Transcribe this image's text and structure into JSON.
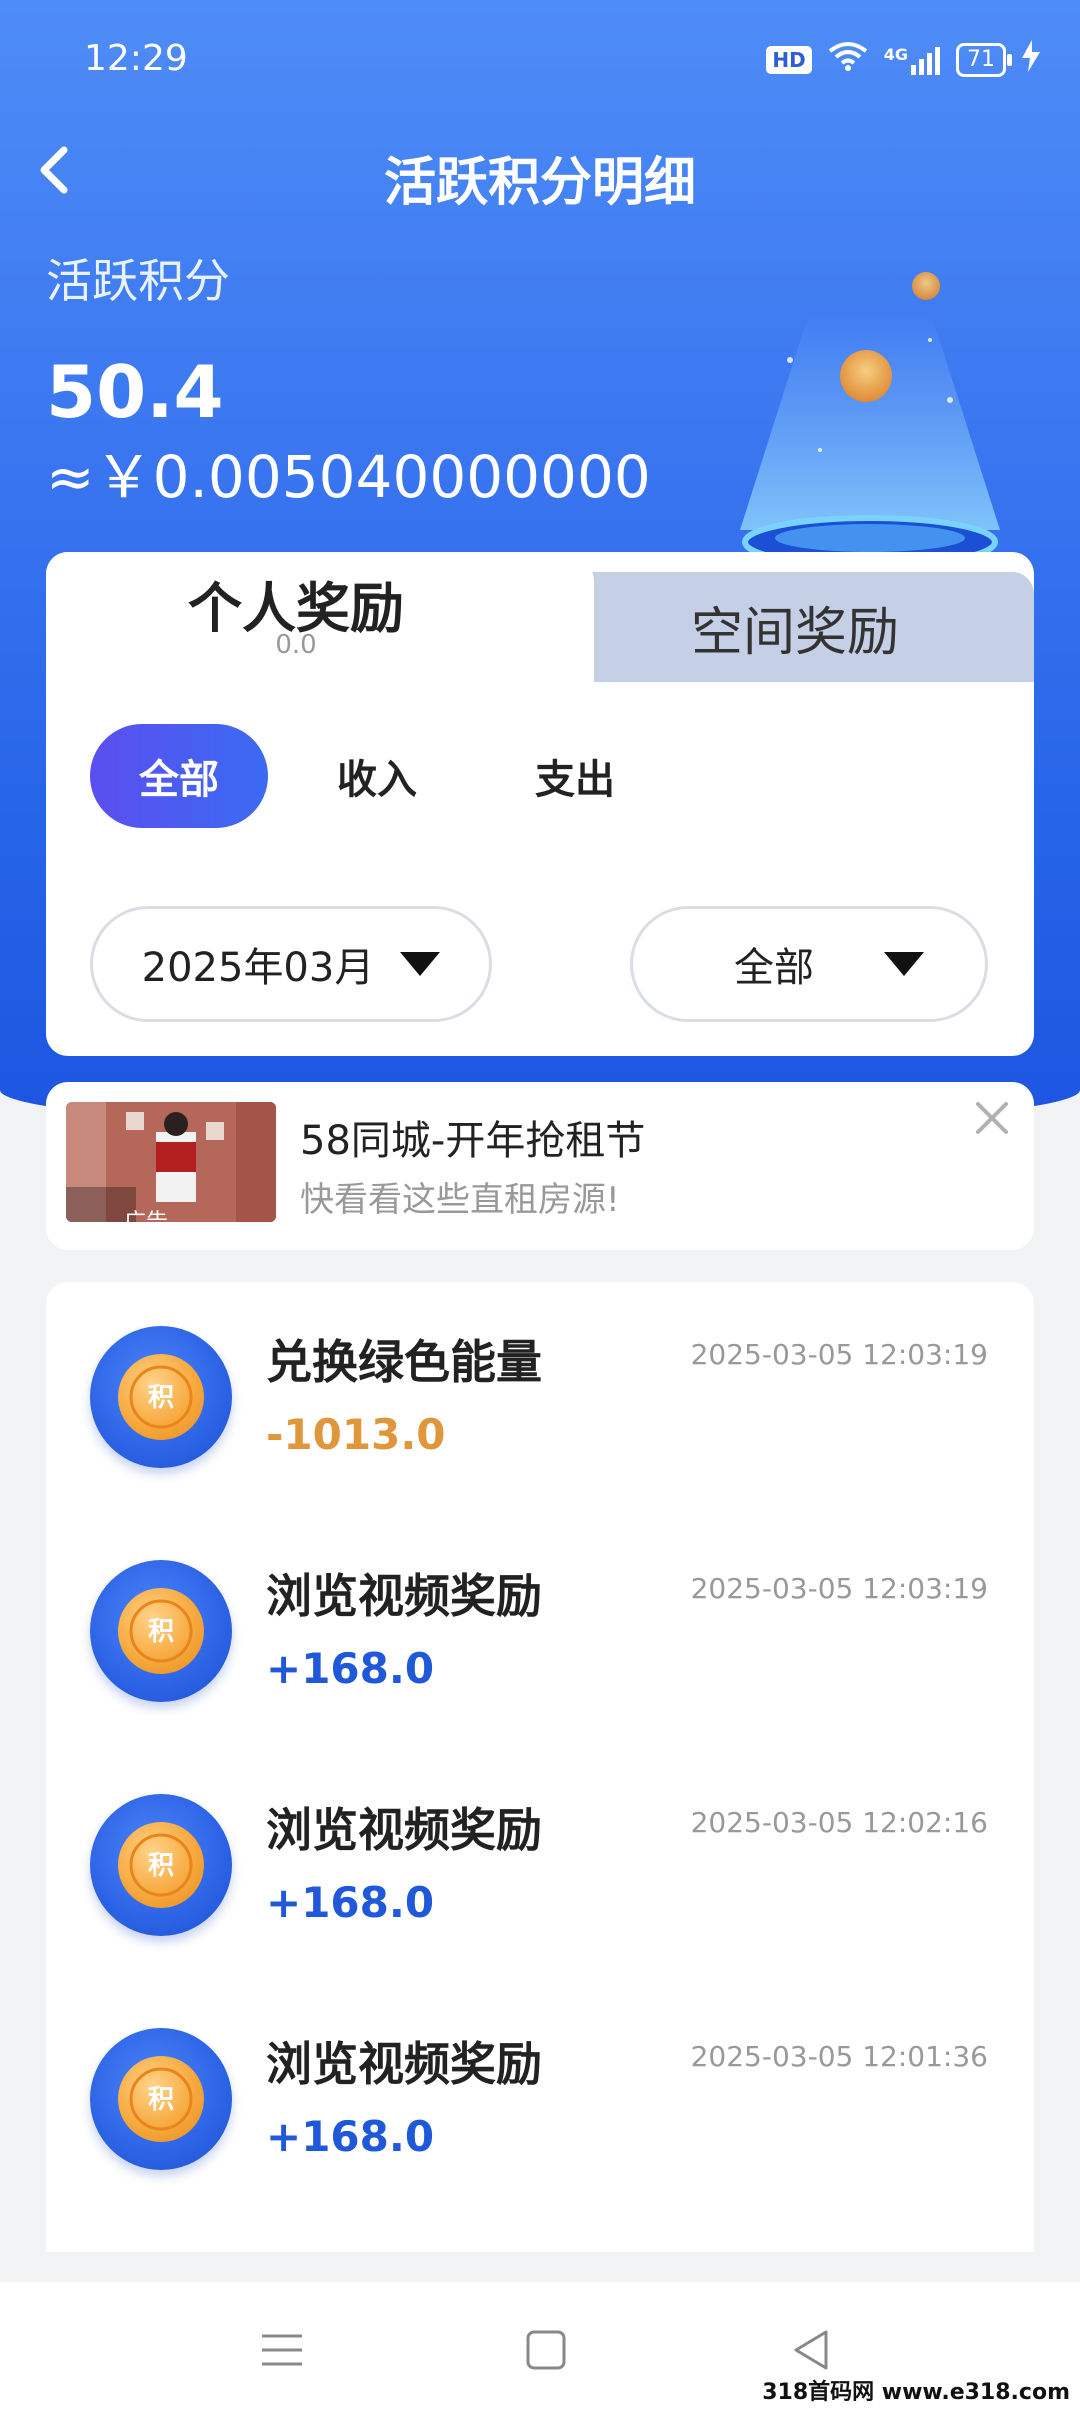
{
  "status": {
    "time": "12:29",
    "hd": "HD",
    "network": "4G",
    "battery": "71"
  },
  "header": {
    "title": "活跃积分明细"
  },
  "summary": {
    "label": "活跃积分",
    "value": "50.4",
    "cny": "≈￥0.005040000000"
  },
  "tabs": [
    {
      "label": "个人奖励",
      "sub": "0.0",
      "active": true
    },
    {
      "label": "空间奖励",
      "active": false
    }
  ],
  "filters": {
    "chips": [
      "全部",
      "收入",
      "支出"
    ],
    "month": "2025年03月",
    "type": "全部"
  },
  "ad": {
    "title": "58同城-开年抢租节",
    "desc": "快看看这些直租房源!",
    "tag": "广告"
  },
  "records": [
    {
      "title": "兑换绿色能量",
      "time": "2025-03-05 12:03:19",
      "amount": "-1013.0",
      "kind": "neg"
    },
    {
      "title": "浏览视频奖励",
      "time": "2025-03-05 12:03:19",
      "amount": "+168.0",
      "kind": "pos"
    },
    {
      "title": "浏览视频奖励",
      "time": "2025-03-05 12:02:16",
      "amount": "+168.0",
      "kind": "pos"
    },
    {
      "title": "浏览视频奖励",
      "time": "2025-03-05 12:01:36",
      "amount": "+168.0",
      "kind": "pos"
    }
  ],
  "coin_glyph": "积",
  "colors": {
    "primary": "#2563e8",
    "negative": "#e0963a",
    "positive": "#1f58d8"
  },
  "watermark": "318首码网 www.e318.com"
}
